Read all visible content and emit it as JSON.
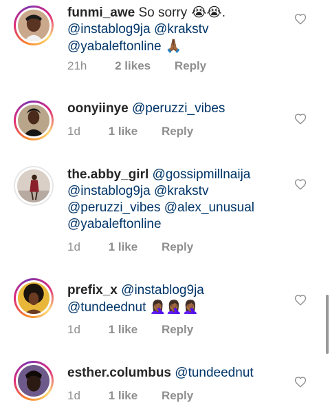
{
  "comments": [
    {
      "username": "funmi_awe",
      "text_parts": [
        "So sorry",
        " 😭😭",
        ".",
        "@instablog9ja",
        "@krakstv",
        "@yabaleftonline",
        " 🙏🏾"
      ],
      "time": "21h",
      "likes": "2 likes",
      "reply": "Reply"
    },
    {
      "username": "oonyiinye",
      "text_parts": [
        "@peruzzi_vibes"
      ],
      "time": "1d",
      "likes": "1 like",
      "reply": "Reply"
    },
    {
      "username": "the.abby_girl",
      "text_parts": [
        "@gossipmillnaija",
        "@instablog9ja",
        "@krakstv",
        "@peruzzi_vibes",
        "@alex_unusual",
        "@yabaleftonline"
      ],
      "time": "1d",
      "likes": "1 like",
      "reply": "Reply"
    },
    {
      "username": "prefix_x",
      "text_parts": [
        "@instablog9ja",
        "@tundeednut",
        "🤦🏾‍♀️🤦🏾‍♀️🤦🏾‍♀️"
      ],
      "time": "1d",
      "likes": "1 like",
      "reply": "Reply"
    },
    {
      "username": "esther.columbus",
      "text_parts": [
        "@tundeednut"
      ],
      "time": "1d",
      "likes": "1 like",
      "reply": "Reply"
    }
  ],
  "colors": {
    "text": "#262626",
    "mention": "#003569",
    "meta": "#8e8e8e"
  },
  "icons": {
    "like": "heart-outline-icon"
  }
}
